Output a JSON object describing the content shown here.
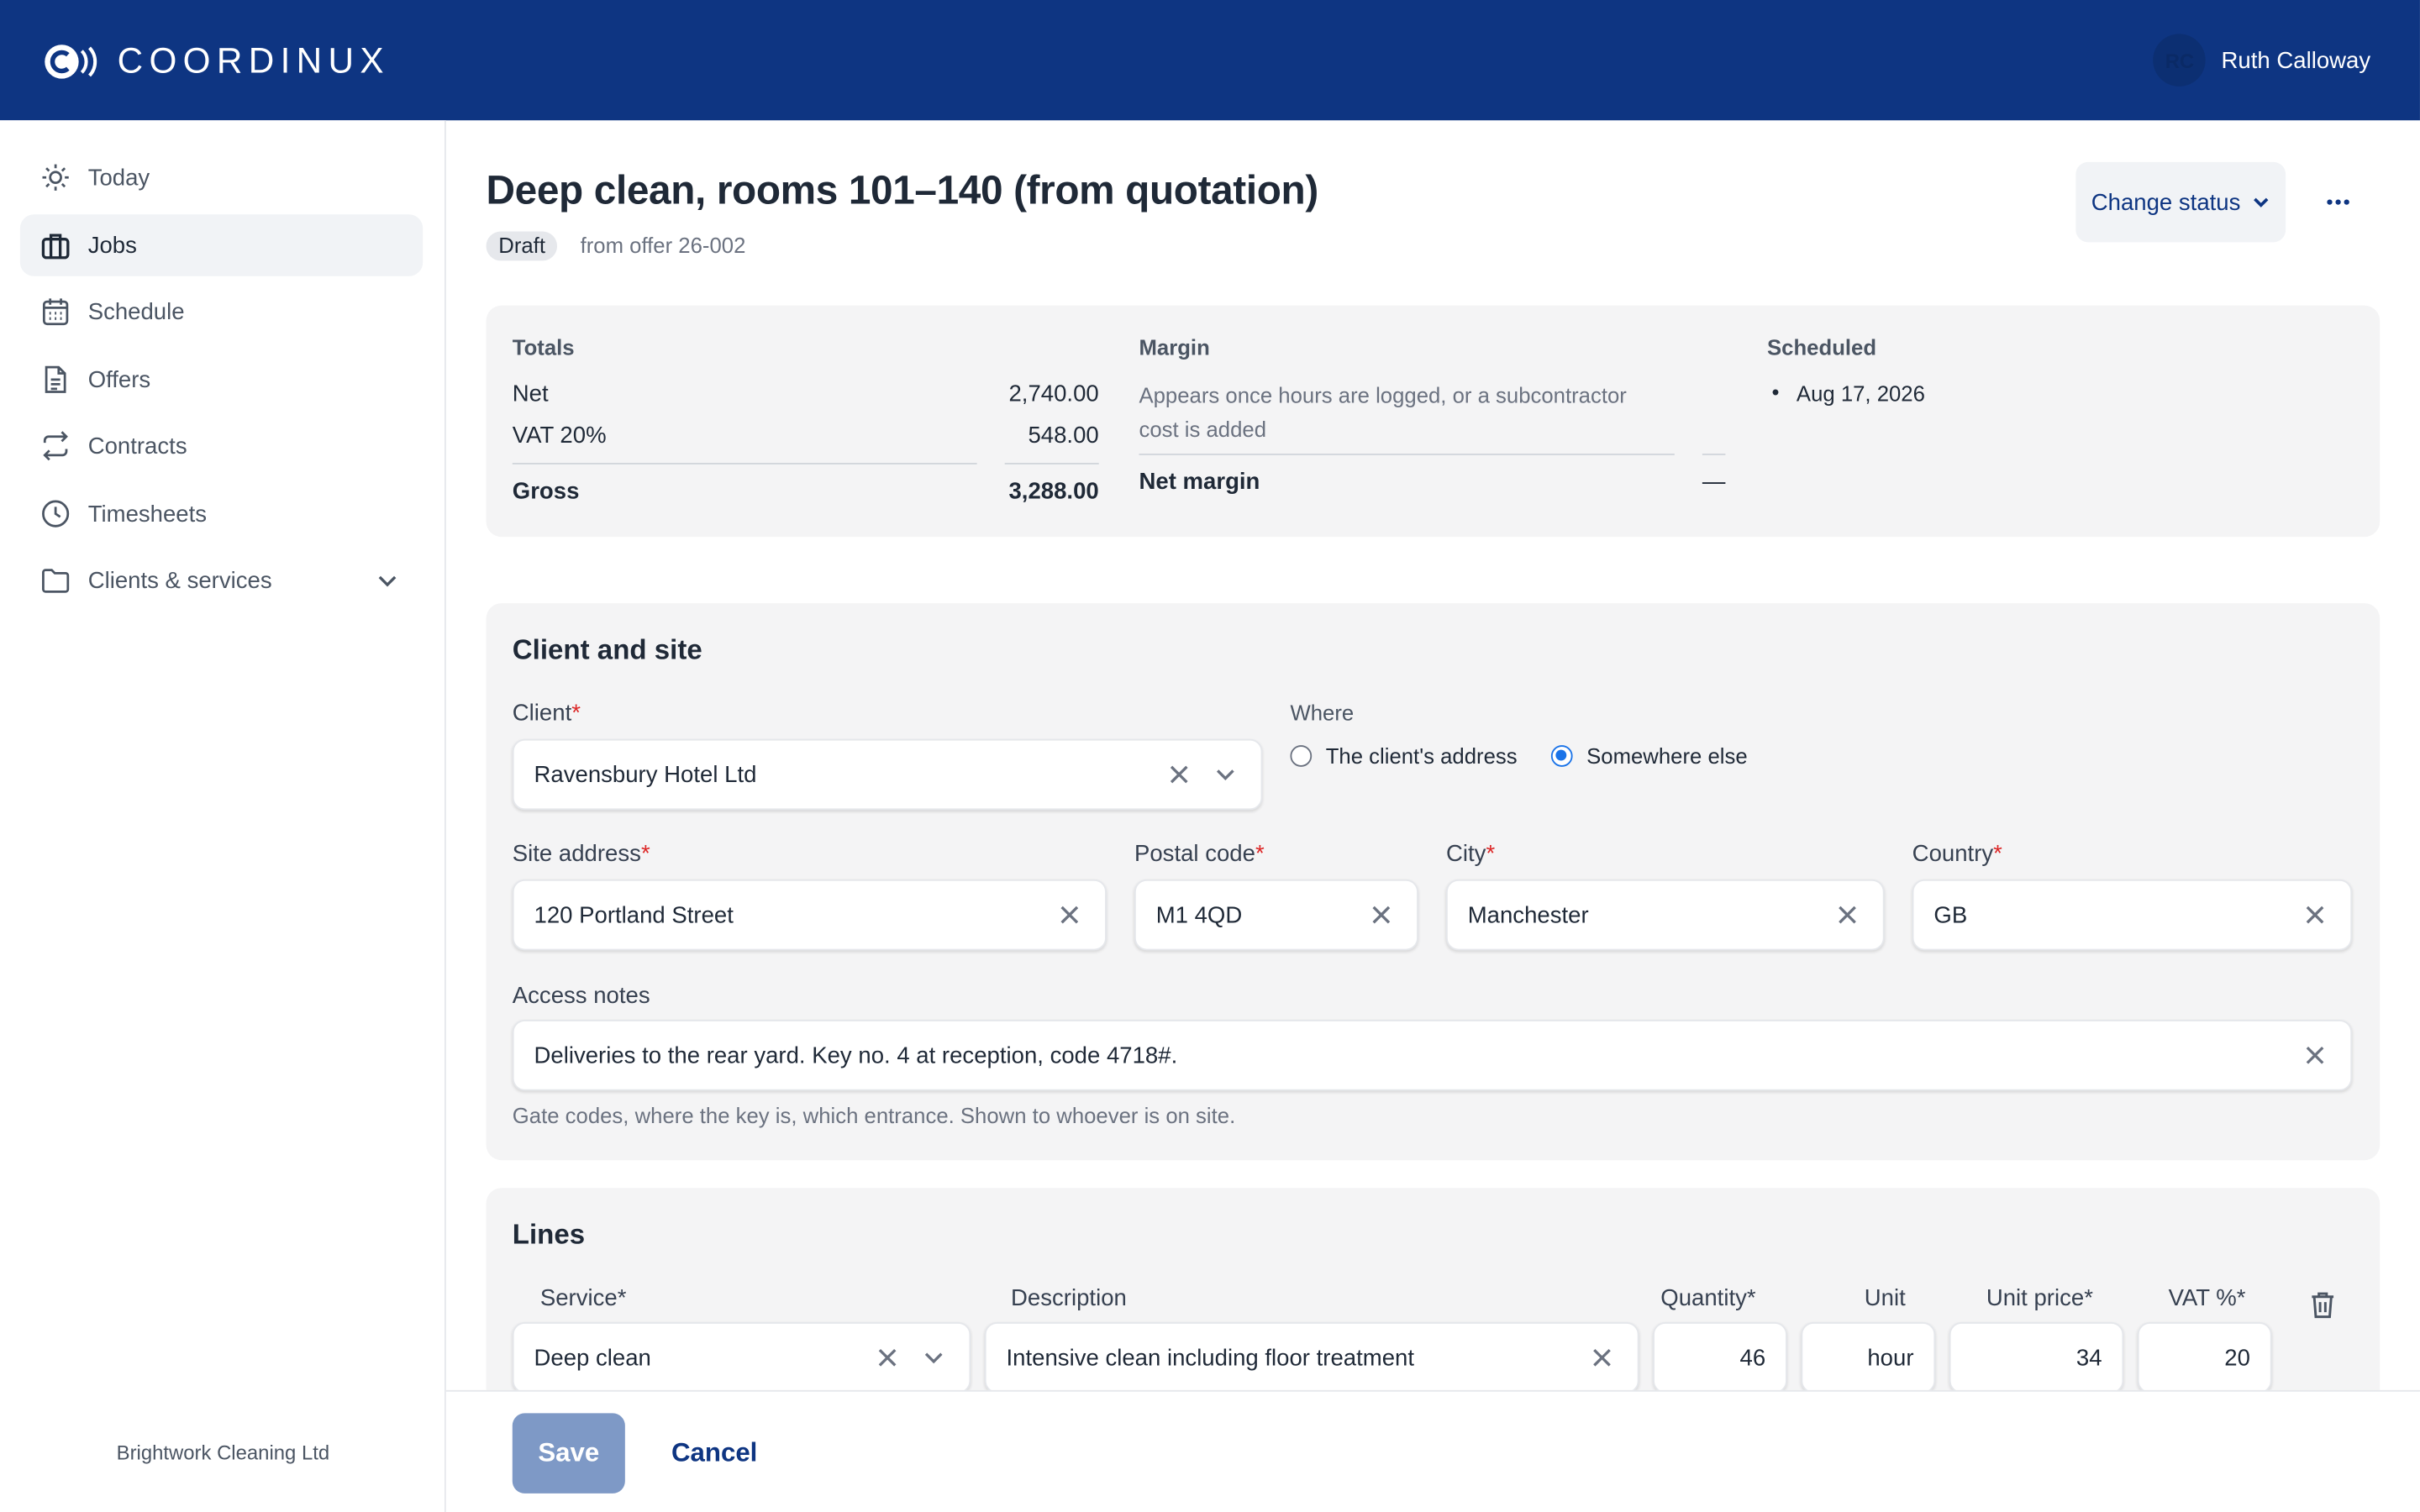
{
  "app": {
    "brand": "COORDINUX",
    "user_initials": "RC",
    "user_name": "Ruth Calloway",
    "company": "Brightwork Cleaning Ltd"
  },
  "sidebar": {
    "items": [
      {
        "label": "Today",
        "icon": "sun-icon"
      },
      {
        "label": "Jobs",
        "icon": "briefcase-icon",
        "active": true
      },
      {
        "label": "Schedule",
        "icon": "calendar-icon"
      },
      {
        "label": "Offers",
        "icon": "document-icon"
      },
      {
        "label": "Contracts",
        "icon": "repeat-arrows-icon"
      },
      {
        "label": "Timesheets",
        "icon": "clock-icon"
      },
      {
        "label": "Clients & services",
        "icon": "folder-icon"
      }
    ]
  },
  "header": {
    "title": "Deep clean, rooms 101–140 (from quotation)",
    "status": "Draft",
    "source": "from offer 26-002",
    "change_status": "Change status"
  },
  "summary": {
    "totals_label": "Totals",
    "net_label": "Net",
    "net_value": "2,740.00",
    "vat_label": "VAT 20%",
    "vat_value": "548.00",
    "gross_label": "Gross",
    "gross_value": "3,288.00",
    "margin_label": "Margin",
    "margin_note": "Appears once hours are logged, or a subcontractor cost is added",
    "net_margin_label": "Net margin",
    "net_margin_value": "—",
    "scheduled_label": "Scheduled",
    "scheduled_date": "Aug 17, 2026"
  },
  "client_site": {
    "title": "Client and site",
    "client_label": "Client",
    "client_value": "Ravensbury Hotel Ltd",
    "where_label": "Where",
    "where_option_1": "The client's address",
    "where_option_2": "Somewhere else",
    "where_selected": "Somewhere else",
    "site_label": "Site address",
    "site_value": "120 Portland Street",
    "postal_label": "Postal code",
    "postal_value": "M1 4QD",
    "city_label": "City",
    "city_value": "Manchester",
    "country_label": "Country",
    "country_value": "GB",
    "access_label": "Access notes",
    "access_value": "Deliveries to the rear yard. Key no. 4 at reception, code 4718#.",
    "access_hint": "Gate codes, where the key is, which entrance. Shown to whoever is on site."
  },
  "lines": {
    "title": "Lines",
    "col_service": "Service*",
    "col_description": "Description",
    "col_quantity": "Quantity*",
    "col_unit": "Unit",
    "col_unit_price": "Unit price*",
    "col_vat": "VAT %*",
    "rows": [
      {
        "service": "Deep clean",
        "description": "Intensive clean including floor treatment",
        "quantity": "46",
        "unit": "hour",
        "unit_price": "34",
        "vat": "20"
      }
    ]
  },
  "footer": {
    "save": "Save",
    "cancel": "Cancel"
  },
  "colors": {
    "brand": "#0e3582",
    "accent": "#1a73e8",
    "required": "#dc2626"
  }
}
